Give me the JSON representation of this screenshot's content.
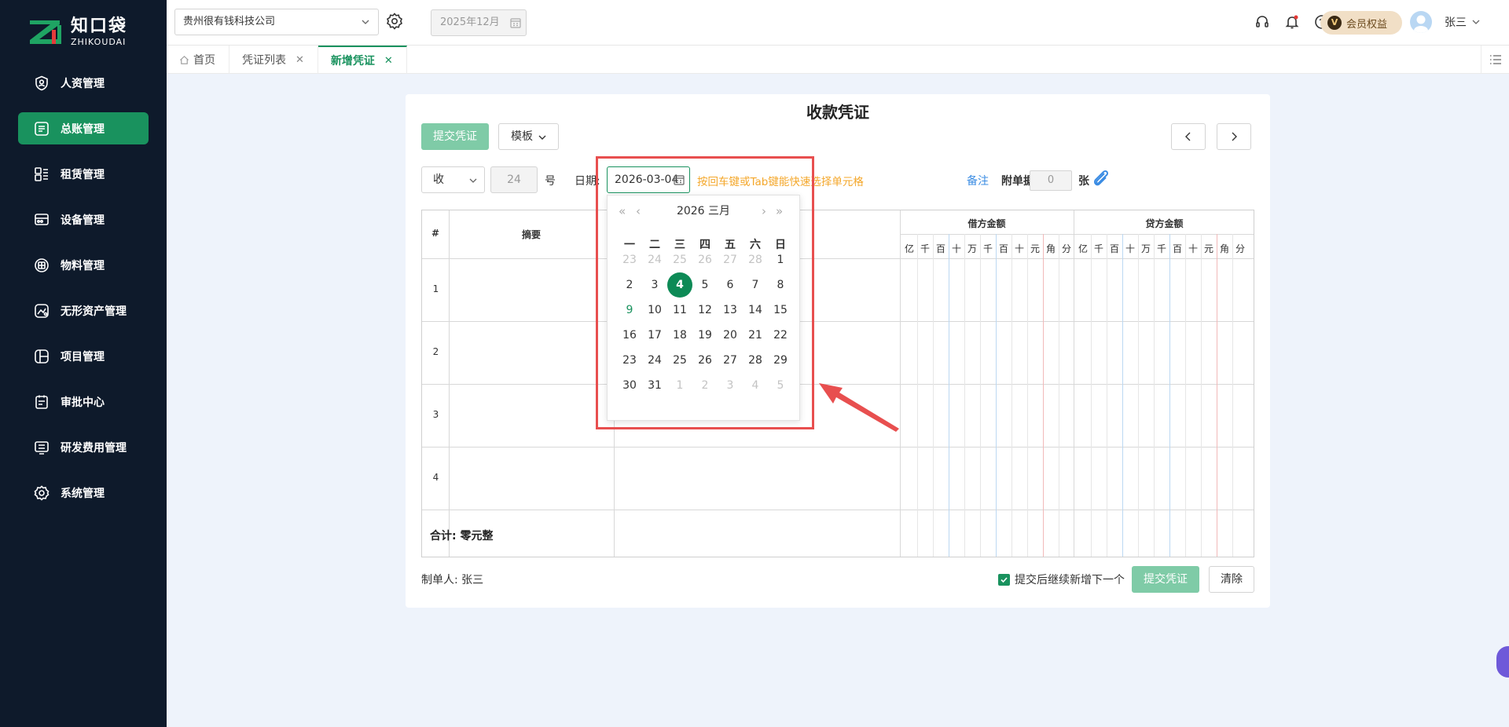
{
  "brand": {
    "name_cn": "知口袋",
    "name_en": "ZHIKOUDAI"
  },
  "sidebar": {
    "items": [
      {
        "label": "人资管理",
        "icon": "person-shield-icon",
        "active": false
      },
      {
        "label": "总账管理",
        "icon": "ledger-icon",
        "active": true
      },
      {
        "label": "租赁管理",
        "icon": "lease-icon",
        "active": false
      },
      {
        "label": "设备管理",
        "icon": "device-icon",
        "active": false
      },
      {
        "label": "物料管理",
        "icon": "box-icon",
        "active": false
      },
      {
        "label": "无形资产管理",
        "icon": "intangible-asset-icon",
        "active": false
      },
      {
        "label": "项目管理",
        "icon": "project-icon",
        "active": false
      },
      {
        "label": "审批中心",
        "icon": "approval-icon",
        "active": false
      },
      {
        "label": "研发费用管理",
        "icon": "rd-expense-icon",
        "active": false
      },
      {
        "label": "系统管理",
        "icon": "settings-icon",
        "active": false
      }
    ]
  },
  "header": {
    "company": "贵州很有钱科技公司",
    "period": "2025年12月",
    "vip_label": "会员权益",
    "vip_badge": "V",
    "username": "张三"
  },
  "tabs": [
    {
      "label": "首页",
      "closable": false,
      "active": false
    },
    {
      "label": "凭证列表",
      "closable": true,
      "active": false
    },
    {
      "label": "新增凭证",
      "closable": true,
      "active": true
    }
  ],
  "voucher": {
    "title": "收款凭证",
    "submit_label": "提交凭证",
    "template_label": "模板",
    "type_value": "收",
    "number_value": "24",
    "number_suffix": "号",
    "date_label": "日期:",
    "date_value": "2026-03-04",
    "hint": "按回车键或Tab键能快速选择单元格",
    "remark_label": "备注",
    "attachment_label": "附单据",
    "attachment_value": "0",
    "attachment_unit": "张",
    "table": {
      "col_index": "#",
      "col_summary": "摘要",
      "col_debit": "借方金额",
      "col_credit": "贷方金额",
      "digits": [
        "亿",
        "千",
        "百",
        "十",
        "万",
        "千",
        "百",
        "十",
        "元",
        "角",
        "分"
      ],
      "rows": [
        "1",
        "2",
        "3",
        "4"
      ],
      "total_label": "合计:",
      "total_value": "零元整"
    },
    "maker_label": "制单人:",
    "maker_value": "张三",
    "continue_label": "提交后继续新增下一个",
    "continue_checked": true,
    "clear_label": "清除"
  },
  "picker": {
    "year": "2026",
    "month": "三月",
    "weekdays": [
      "一",
      "二",
      "三",
      "四",
      "五",
      "六",
      "日"
    ],
    "weeks": [
      [
        "23",
        "24",
        "25",
        "26",
        "27",
        "28",
        "1"
      ],
      [
        "2",
        "3",
        "4",
        "5",
        "6",
        "7",
        "8"
      ],
      [
        "9",
        "10",
        "11",
        "12",
        "13",
        "14",
        "15"
      ],
      [
        "16",
        "17",
        "18",
        "19",
        "20",
        "21",
        "22"
      ],
      [
        "23",
        "24",
        "25",
        "26",
        "27",
        "28",
        "29"
      ],
      [
        "30",
        "31",
        "1",
        "2",
        "3",
        "4",
        "5"
      ]
    ],
    "selected": "4",
    "today": "9"
  },
  "colors": {
    "accent": "#19925e",
    "sidebar_bg": "#0e1a2b",
    "hint": "#f4a72a",
    "link": "#3b8ce3",
    "highlight": "#e84f4f"
  }
}
